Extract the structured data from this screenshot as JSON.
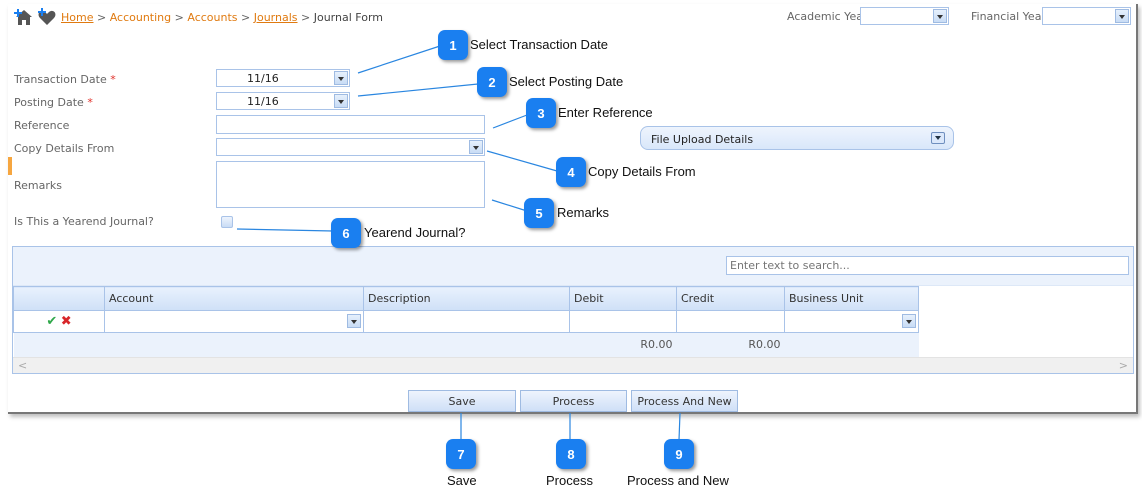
{
  "breadcrumb": {
    "items": [
      {
        "label": "Home",
        "underlined": true
      },
      {
        "label": "Accounting",
        "underlined": false
      },
      {
        "label": "Accounts",
        "underlined": false
      },
      {
        "label": "Journals",
        "underlined": true
      }
    ],
    "separator": ">",
    "current": "Journal Form"
  },
  "header": {
    "academic_year_label": "Academic Year",
    "academic_year_value": "",
    "financial_year_label": "Financial Year",
    "financial_year_value": ""
  },
  "form": {
    "transaction_date": {
      "label": "Transaction Date",
      "required": "*",
      "value": "11/16"
    },
    "posting_date": {
      "label": "Posting Date",
      "required": "*",
      "value": "11/16"
    },
    "reference": {
      "label": "Reference",
      "value": ""
    },
    "copy_details_from": {
      "label": "Copy Details From",
      "value": ""
    },
    "remarks": {
      "label": "Remarks",
      "value": ""
    },
    "yearend": {
      "label": "Is This a Yearend Journal?",
      "checked": false
    }
  },
  "file_upload": {
    "label": "File Upload Details"
  },
  "grid": {
    "search_placeholder": "Enter text to search...",
    "columns": [
      "",
      "Account",
      "Description",
      "Debit",
      "Credit",
      "Business Unit"
    ],
    "footer": {
      "debit_total": "R0.00",
      "credit_total": "R0.00"
    },
    "scroll_left": "<",
    "scroll_right": ">"
  },
  "buttons": {
    "save": "Save",
    "process": "Process",
    "process_and_new": "Process And New"
  },
  "callouts": [
    {
      "num": "1",
      "text": "Select Transaction Date"
    },
    {
      "num": "2",
      "text": "Select Posting Date"
    },
    {
      "num": "3",
      "text": "Enter Reference"
    },
    {
      "num": "4",
      "text": "Copy Details From"
    },
    {
      "num": "5",
      "text": "Remarks"
    },
    {
      "num": "6",
      "text": "Yearend Journal?"
    },
    {
      "num": "7",
      "text": "Save"
    },
    {
      "num": "8",
      "text": "Process"
    },
    {
      "num": "9",
      "text": "Process and New"
    }
  ],
  "colors": {
    "callout": "#1a7ff0",
    "link": "#e07a10",
    "required": "#e0302a",
    "border": "#a9c3e8"
  }
}
